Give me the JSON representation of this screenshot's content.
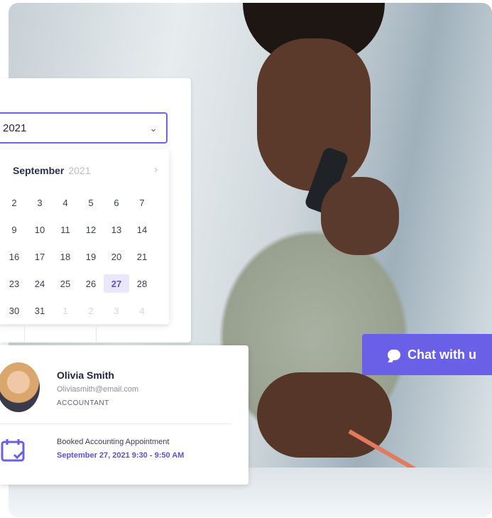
{
  "date_picker": {
    "field_value": "2021",
    "month": "September",
    "year": "2021",
    "days": [
      [
        "2",
        "3",
        "4",
        "5",
        "6",
        "7"
      ],
      [
        "9",
        "10",
        "11",
        "12",
        "13",
        "14"
      ],
      [
        "16",
        "17",
        "18",
        "19",
        "20",
        "21"
      ],
      [
        "23",
        "24",
        "25",
        "26",
        "27",
        "28"
      ],
      [
        "30",
        "31",
        "1",
        "2",
        "3",
        "4"
      ]
    ],
    "selected_day": "27"
  },
  "appointment": {
    "name": "Olivia Smith",
    "email": "Oliviasmith@email.com",
    "role": "ACCOUNTANT",
    "booked_label": "Booked Accounting Appointment",
    "when": "September 27, 2021 9:30 - 9:50 AM"
  },
  "chat": {
    "label": "Chat with u"
  },
  "colors": {
    "accent": "#6a60e8",
    "selected_bg": "#e9e8fb"
  }
}
